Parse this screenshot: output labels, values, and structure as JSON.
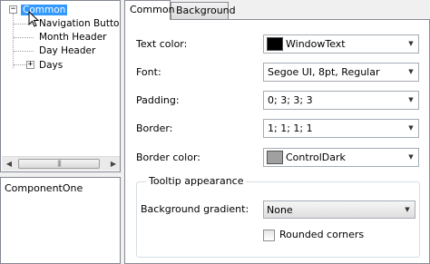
{
  "tree": {
    "nodes": [
      {
        "label": "Common",
        "selected": true,
        "expander": "−"
      },
      {
        "label": "Navigation Buttons"
      },
      {
        "label": "Month Header"
      },
      {
        "label": "Day Header"
      },
      {
        "label": "Days",
        "expander": "+"
      }
    ],
    "scrollbar": {
      "grip": "|||",
      "left_arrow": "◀",
      "right_arrow": "▶"
    }
  },
  "description": {
    "text": "ComponentOne"
  },
  "tabs": [
    {
      "label": "Common",
      "active": true
    },
    {
      "label": "Background",
      "active": false
    }
  ],
  "properties": {
    "text_color": {
      "label": "Text color:",
      "value": "WindowText",
      "swatch": "#000000"
    },
    "font": {
      "label": "Font:",
      "value": "Segoe UI, 8pt, Regular"
    },
    "padding": {
      "label": "Padding:",
      "value": "0; 3; 3; 3"
    },
    "border": {
      "label": "Border:",
      "value": "1; 1; 1; 1"
    },
    "border_color": {
      "label": "Border color:",
      "value": "ControlDark",
      "swatch": "#a0a0a0"
    }
  },
  "tooltip": {
    "title": "Tooltip appearance",
    "gradient_label": "Background gradient:",
    "gradient_value": "None",
    "rounded_corners_label": "Rounded corners",
    "rounded_corners_checked": false
  },
  "glyphs": {
    "dropdown": "▼"
  },
  "colors": {
    "selection": "#3399ff",
    "border": "#828790"
  }
}
